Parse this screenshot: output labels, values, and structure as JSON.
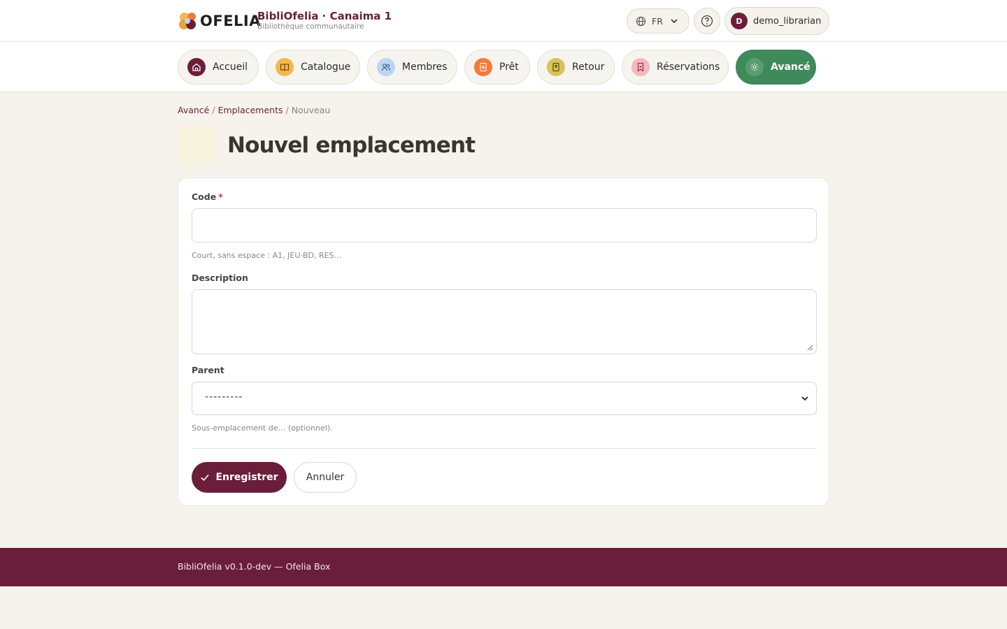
{
  "header": {
    "logo_text": "OFELIA",
    "brand_name": "BibliOfelia · Canaima 1",
    "brand_subtitle": "Bibliothèque communautaire",
    "language": "FR",
    "user_initial": "D",
    "username": "demo_librarian"
  },
  "nav": {
    "items": [
      {
        "label": "Accueil",
        "icon": "home-icon",
        "icon_bg": "#6b1e3a",
        "icon_fg": "#ffffff"
      },
      {
        "label": "Catalogue",
        "icon": "book-open-icon",
        "icon_bg": "#f2b84b",
        "icon_fg": "#6b3a10"
      },
      {
        "label": "Membres",
        "icon": "users-icon",
        "icon_bg": "#bcd6f2",
        "icon_fg": "#2f5a8a"
      },
      {
        "label": "Prêt",
        "icon": "checkout-icon",
        "icon_bg": "#f07b3a",
        "icon_fg": "#ffffff"
      },
      {
        "label": "Retour",
        "icon": "return-icon",
        "icon_bg": "#d9c35a",
        "icon_fg": "#4a3a10"
      },
      {
        "label": "Réservations",
        "icon": "bookmark-icon",
        "icon_bg": "#f5b8be",
        "icon_fg": "#8a2a3a"
      },
      {
        "label": "Avancé",
        "icon": "gear-icon",
        "icon_bg": "#5a9c70",
        "icon_fg": "#ffffff",
        "active": true
      }
    ]
  },
  "breadcrumb": {
    "items": [
      "Avancé",
      "Emplacements"
    ],
    "current": "Nouveau",
    "separator": "/"
  },
  "page": {
    "title": "Nouvel emplacement"
  },
  "form": {
    "code_label": "Code",
    "code_required_mark": "*",
    "code_value": "",
    "code_help": "Court, sans espace : A1, JEU-BD, RES…",
    "description_label": "Description",
    "description_value": "",
    "parent_label": "Parent",
    "parent_selected": "---------",
    "parent_help": "Sous-emplacement de… (optionnel).",
    "save_label": "Enregistrer",
    "cancel_label": "Annuler"
  },
  "footer": {
    "text": "BibliOfelia v0.1.0-dev — Ofelia Box"
  },
  "colors": {
    "brand": "#6b1e3a",
    "active_nav": "#3f8a5a",
    "background": "#f5f3ec"
  }
}
